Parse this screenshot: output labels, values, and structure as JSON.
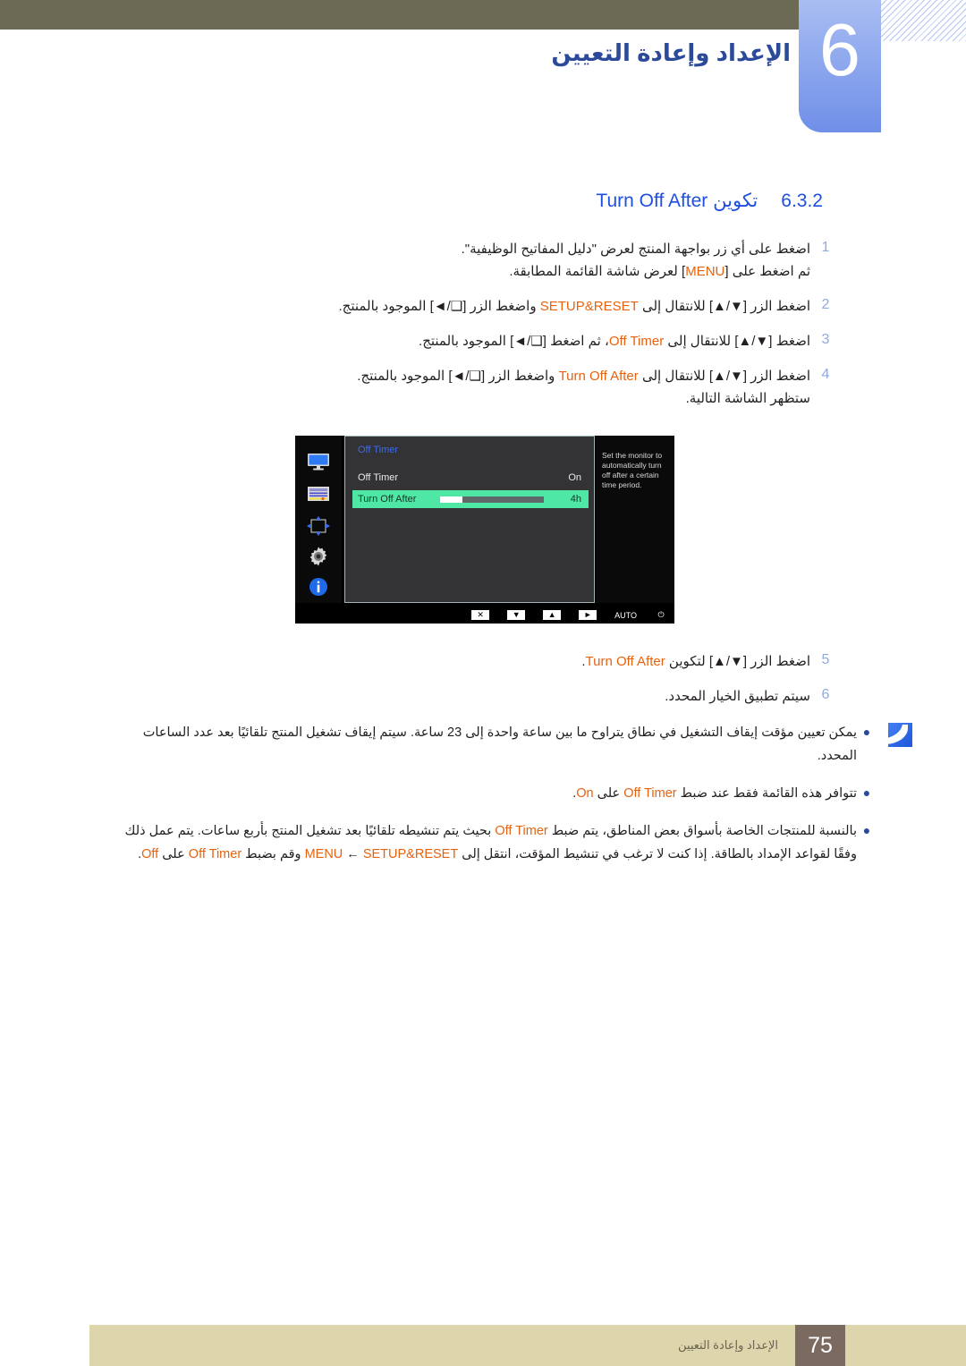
{
  "header": {
    "chapter_number": "6",
    "chapter_title": "الإعداد وإعادة التعيين"
  },
  "section": {
    "number": "6.3.2",
    "title_ar": "تكوين",
    "title_en": "Turn Off After"
  },
  "steps": [
    {
      "num": "1",
      "lines": [
        "اضغط على أي زر بواجهة المنتج لعرض \"دليل المفاتيح الوظيفية\".",
        "ثم اضغط على [MENU] لعرض شاشة القائمة المطابقة."
      ]
    },
    {
      "num": "2",
      "lines": [
        "اضغط الزر [▲/▼] للانتقال إلى SETUP&RESET واضغط الزر [◄/❑] الموجود بالمنتج."
      ]
    },
    {
      "num": "3",
      "lines": [
        "اضغط [▲/▼] للانتقال إلى Off Timer، ثم اضغط [◄/❑] الموجود بالمنتج."
      ]
    },
    {
      "num": "4",
      "lines": [
        "اضغط الزر [▲/▼] للانتقال إلى Turn Off After واضغط الزر [◄/❑] الموجود بالمنتج.",
        "ستظهر الشاشة التالية."
      ]
    },
    {
      "num": "5",
      "lines": [
        "اضغط الزر [▲/▼] لتكوين Turn Off After."
      ]
    },
    {
      "num": "6",
      "lines": [
        "سيتم تطبيق الخيار المحدد."
      ]
    }
  ],
  "osd": {
    "title": "Off Timer",
    "sidebar_icons": [
      "monitor-icon",
      "picture-settings-icon",
      "position-arrows-icon",
      "gear-icon",
      "info-icon"
    ],
    "rows": [
      {
        "label": "Off Timer",
        "value": "On",
        "selected": false,
        "has_slider": false
      },
      {
        "label": "Turn Off After",
        "value": "4h",
        "selected": true,
        "has_slider": true,
        "slider_percent": 22
      }
    ],
    "help_text": "Set the monitor to automatically turn off after a certain time period.",
    "bottom_keys": [
      {
        "glyph": "✕",
        "name": "close-key",
        "boxed": true
      },
      {
        "glyph": "▼",
        "name": "down-key",
        "boxed": true
      },
      {
        "glyph": "▲",
        "name": "up-key",
        "boxed": true
      },
      {
        "glyph": "►",
        "name": "enter-key",
        "boxed": true
      },
      {
        "glyph": "AUTO",
        "name": "auto-key",
        "boxed": false
      },
      {
        "glyph": "⏻",
        "name": "power-key",
        "boxed": false
      }
    ]
  },
  "notes": [
    {
      "bullet": "●",
      "text": "يمكن تعيين مؤقت إيقاف التشغيل في نطاق يتراوح ما بين ساعة واحدة إلى 23 ساعة. سيتم إيقاف تشغيل المنتج تلقائيًا بعد عدد الساعات المحدد."
    },
    {
      "bullet": "●",
      "text": "تتوافر هذه القائمة فقط عند ضبط Off Timer على On."
    },
    {
      "bullet": "●",
      "text": "بالنسبة للمنتجات الخاصة بأسواق بعض المناطق، يتم ضبط Off Timer بحيث يتم تنشيطه تلقائيًا بعد تشغيل المنتج بأربع ساعات. يتم عمل ذلك وفقًا لقواعد الإمداد بالطاقة. إذا كنت لا ترغب في تنشيط المؤقت، انتقل إلى MENU ← SETUP&RESET وقم بضبط Off Timer على Off."
    }
  ],
  "footer": {
    "page_number": "75",
    "chapter_title": "الإعداد وإعادة التعيين"
  },
  "colors": {
    "header_band": "#6b6b55",
    "chapter_tab": "#8fa9ee",
    "heading_blue": "#1f4fe0",
    "highlight_orange": "#e8620d",
    "osd_selected_green": "#4ee8a4",
    "footer_band": "#ddd6ac",
    "footer_page_box": "#7a6a5f"
  }
}
